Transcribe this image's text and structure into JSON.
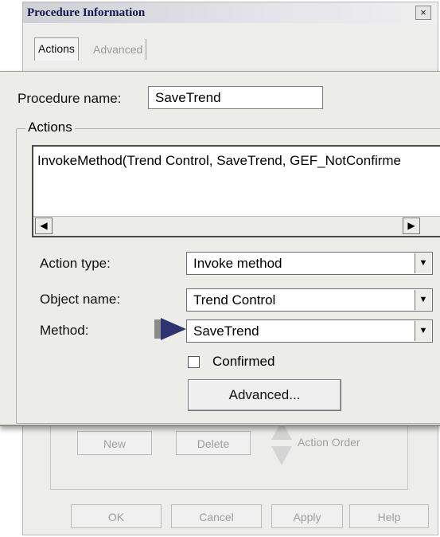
{
  "dialog": {
    "title": "Procedure Information",
    "close_glyph": "×",
    "tabs": [
      {
        "label": "Actions",
        "active": true
      },
      {
        "label": "Advanced",
        "active": false
      }
    ]
  },
  "procedure": {
    "name_label": "Procedure name:",
    "name_value": "SaveTrend"
  },
  "actions": {
    "group_label": "Actions",
    "items": [
      "InvokeMethod(Trend Control, SaveTrend, GEF_NotConfirme"
    ]
  },
  "fields": {
    "action_type_label": "Action type:",
    "action_type_value": "Invoke method",
    "object_name_label": "Object name:",
    "object_name_value": "Trend Control",
    "method_label": "Method:",
    "method_value": "SaveTrend",
    "confirmed_label": "Confirmed",
    "confirmed_checked": false
  },
  "buttons": {
    "advanced": "Advanced...",
    "new": "New",
    "delete": "Delete",
    "action_order": "Action Order",
    "ok": "OK",
    "cancel": "Cancel",
    "apply": "Apply",
    "help": "Help"
  },
  "icons": {
    "scroll_left": "scroll-left-arrow-icon",
    "scroll_right": "scroll-right-arrow-icon",
    "dropdown": "chevron-down-icon",
    "pointer": "pointer-arrow-icon"
  },
  "colors": {
    "pointer_arrow": "#2f3372",
    "title_text": "#17174a",
    "panel_bg": "#ecece9"
  }
}
